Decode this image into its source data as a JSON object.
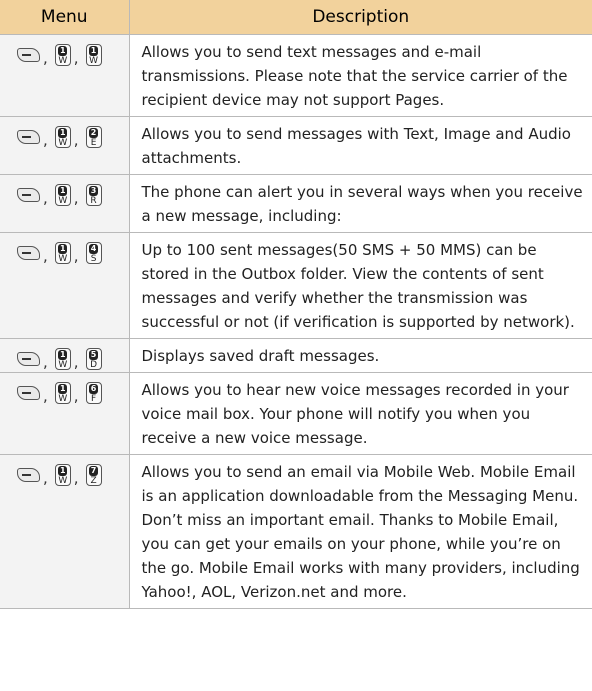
{
  "table": {
    "header": {
      "menu": "Menu",
      "description": "Description"
    },
    "rows": [
      {
        "keys": [
          {
            "num": "1",
            "letter": "W"
          },
          {
            "num": "1",
            "letter": "W"
          }
        ],
        "description": "Allows you to send text messages and e-mail transmissions. Please note that the service carrier of the recipient device may not support Pages."
      },
      {
        "keys": [
          {
            "num": "1",
            "letter": "W"
          },
          {
            "num": "2",
            "letter": "E"
          }
        ],
        "description": "Allows you to send messages with Text, Image and Audio attachments."
      },
      {
        "keys": [
          {
            "num": "1",
            "letter": "W"
          },
          {
            "num": "3",
            "letter": "R"
          }
        ],
        "description": "The phone can alert you in several ways when you receive a new message, including:"
      },
      {
        "keys": [
          {
            "num": "1",
            "letter": "W"
          },
          {
            "num": "4",
            "letter": "S"
          }
        ],
        "description": "Up to 100 sent messages(50 SMS + 50 MMS) can be stored in the Outbox folder. View the contents of sent messages and verify whether the transmission was successful or not (if verification is supported by network)."
      },
      {
        "keys": [
          {
            "num": "1",
            "letter": "W"
          },
          {
            "num": "5",
            "letter": "D"
          }
        ],
        "description": "Displays saved draft messages."
      },
      {
        "keys": [
          {
            "num": "1",
            "letter": "W"
          },
          {
            "num": "6",
            "letter": "F"
          }
        ],
        "description": "Allows you to hear new voice messages recorded in your voice mail box. Your phone will notify you when you receive a new voice message."
      },
      {
        "keys": [
          {
            "num": "1",
            "letter": "W"
          },
          {
            "num": "7",
            "letter": "Z"
          }
        ],
        "description": "Allows you to send an email via Mobile Web. Mobile Email is an application downloadable from the Messaging Menu. Don’t miss an important email. Thanks to Mobile Email, you can get your emails on your phone, while you’re on the go. Mobile Email works with many providers, including Yahoo!, AOL, Verizon.net and more."
      }
    ]
  },
  "icons": {
    "soft_key": "left-soft-key-icon",
    "number_key": "number-key-icon"
  },
  "colors": {
    "header_bg": "#f2d29c",
    "menu_col_bg": "#f3f3f3",
    "rule": "#b9b9b9"
  }
}
